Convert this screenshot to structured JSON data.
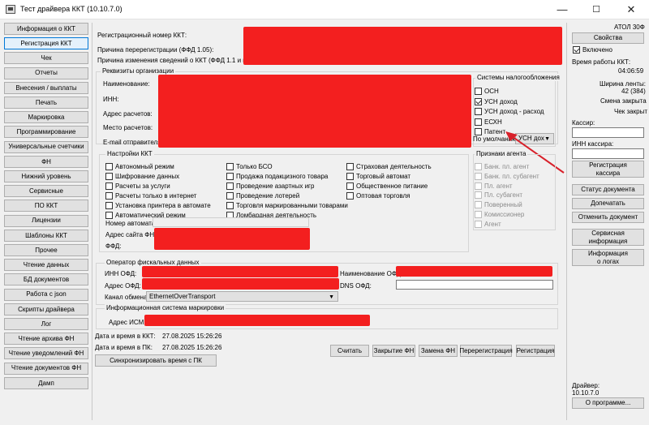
{
  "window": {
    "title": "Тест драйвера ККТ (10.10.7.0)",
    "min": "—",
    "max": "☐",
    "close": "✕"
  },
  "left_nav": [
    "Информация о ККТ",
    "Регистрация ККТ",
    "Чек",
    "Отчеты",
    "Внесения / выплаты",
    "Печать",
    "Маркировка",
    "Программирование",
    "Универсальные счетчики",
    "ФН",
    "Нижний уровень",
    "Сервисные",
    "ПО ККТ",
    "Лицензии",
    "Шаблоны ККТ",
    "Прочее",
    "Чтение данных",
    "БД документов",
    "Работа с json",
    "Скрипты драйвера",
    "Лог",
    "Чтение архива ФН",
    "Чтение уведомлений ФН",
    "Чтение документов ФН",
    "Дамп"
  ],
  "selected_nav": "Регистрация ККТ",
  "top": {
    "reg_number": "Регистрационный номер ККТ:",
    "rereg_reason": "Причина перерегистрации (ФФД 1.05):",
    "change_reason": "Причина изменения сведений о ККТ (ФФД 1.1 и выше):"
  },
  "org": {
    "title": "Реквизиты организации",
    "name": "Наименование:",
    "inn": "ИНН:",
    "address": "Адрес расчетов:",
    "place": "Место расчетов:",
    "email": "E-mail отправителя:"
  },
  "tax": {
    "title": "Системы налогообложения",
    "items": [
      {
        "label": "ОСН",
        "checked": false
      },
      {
        "label": "УСН доход",
        "checked": true
      },
      {
        "label": "УСН доход - расход",
        "checked": false
      },
      {
        "label": "ЕСХН",
        "checked": false
      },
      {
        "label": "Патент",
        "checked": false
      }
    ],
    "default_label": "По умолчанию:",
    "default_value": "УСН дох"
  },
  "kkt_settings": {
    "title": "Настройки ККТ",
    "col1": [
      "Автономный режим",
      "Шифрование данных",
      "Расчеты за услуги",
      "Расчеты только в интернет",
      "Установка принтера в автомате",
      "Автоматический режим"
    ],
    "col2": [
      "Только БСО",
      "Продажа подакцизного товара",
      "Проведение азартных игр",
      "Проведение лотерей",
      "Торговля маркированными товарами",
      "Ломбардная деятельность"
    ],
    "col3": [
      "Страховая деятельность",
      "Торговый автомат",
      "Общественное питание",
      "Оптовая торговля"
    ],
    "automat_number": "Номер автомата:",
    "fns_site": "Адрес сайта ФНС:",
    "ffd": "ФФД:"
  },
  "agent": {
    "title": "Признаки агента",
    "items": [
      "Банк. пл. агент",
      "Банк. пл. субагент",
      "Пл. агент",
      "Пл. субагент",
      "Поверенный",
      "Комиссионер",
      "Агент"
    ]
  },
  "ofd": {
    "title": "Оператор фискальных данных",
    "inn": "ИНН ОФД:",
    "name": "Наименование ОФД:",
    "address": "Адрес ОФД:",
    "dns": "DNS ОФД:",
    "channel_label": "Канал обмена:",
    "channel_value": "EthernetOverTransport"
  },
  "ism": {
    "title": "Информационная система маркировки",
    "address": "Адрес ИСМ:"
  },
  "datetime": {
    "kkt_label": "Дата и время в ККТ:",
    "kkt_value": "27.08.2025 15:26:26",
    "pc_label": "Дата и время в ПК:",
    "pc_value": "27.08.2025 15:26:26",
    "sync": "Синхронизировать время с ПК"
  },
  "actions": [
    "Считать",
    "Закрытие ФН",
    "Замена ФН",
    "Перерегистрация",
    "Регистрация"
  ],
  "right": {
    "device": "АТОЛ 30Ф",
    "properties": "Свойства",
    "enabled": "Включено",
    "uptime_label": "Время работы ККТ:",
    "uptime": "04:06:59",
    "tape_label": "Ширина ленты:",
    "tape": "42 (384)",
    "shift": "Смена закрыта",
    "receipt": "Чек закрыт",
    "cashier": "Кассир:",
    "cashier_inn": "ИНН кассира:",
    "reg_cashier": "Регистрация кассира",
    "doc_status": "Статус документа",
    "print_again": "Допечатать",
    "cancel_doc": "Отменить документ",
    "service_info": "Сервисная информация",
    "log_info": "Информация о логах",
    "driver_label": "Драйвер:",
    "driver_version": "10.10.7.0",
    "about": "О программе..."
  },
  "colors": {
    "redaction": "#f31f1f",
    "accent": "#0078d7",
    "arrow": "#d8202a"
  }
}
